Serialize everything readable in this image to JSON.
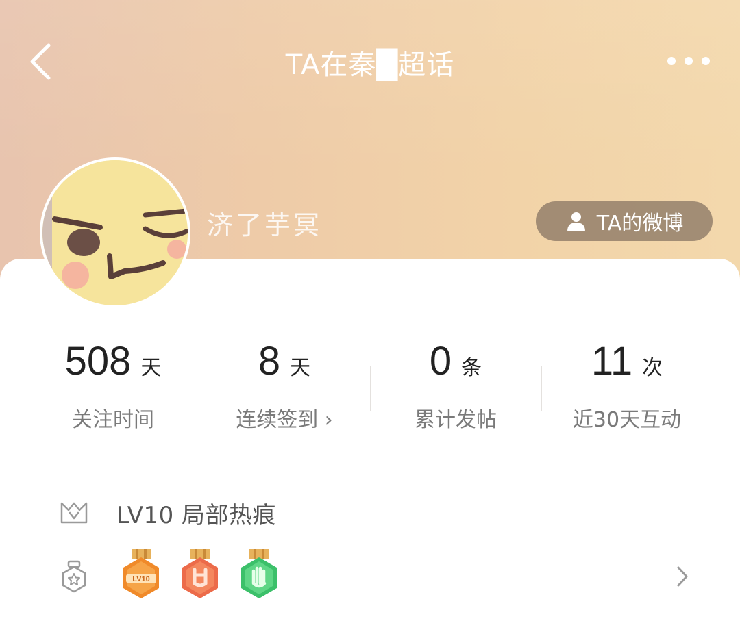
{
  "header": {
    "title": "TA在秦█超话",
    "back_icon": "back-arrow-icon",
    "more_icon": "more-dots-icon"
  },
  "profile": {
    "username": "济了芋冥",
    "weibo_button_label": "TA的微博",
    "weibo_icon": "person-icon"
  },
  "stats": [
    {
      "value": "508",
      "unit": "天",
      "label": "关注时间"
    },
    {
      "value": "8",
      "unit": "天",
      "label": "连续签到 ›"
    },
    {
      "value": "0",
      "unit": "条",
      "label": "累计发帖"
    },
    {
      "value": "11",
      "unit": "次",
      "label": "近30天互动"
    }
  ],
  "level": {
    "icon": "crown-level-icon",
    "text": "LV10 局部热痕"
  },
  "badges": {
    "icon": "medal-icon",
    "items": [
      "LV10",
      "rock-hand",
      "palm-hand"
    ],
    "chevron_icon": "chevron-right-icon"
  },
  "colors": {
    "header_left": "#e8c4ae",
    "header_right": "#f3d8ac",
    "badge_orange": "#f08a2a",
    "badge_red": "#ec6b4a",
    "badge_green": "#3cc06a"
  }
}
